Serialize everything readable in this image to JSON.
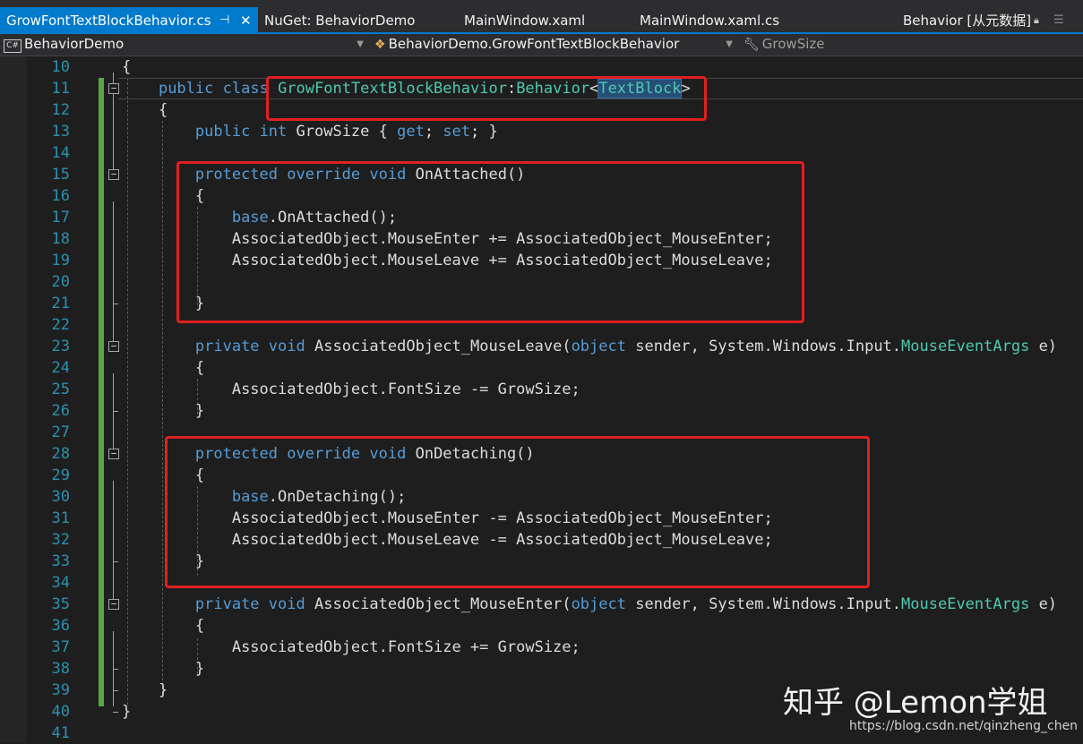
{
  "tabs": [
    {
      "label": "GrowFontTextBlockBehavior.cs",
      "active": true,
      "pin_icon": "pin-icon",
      "close_icon": "close-icon"
    },
    {
      "label": "NuGet: BehaviorDemo",
      "active": false
    },
    {
      "label": "MainWindow.xaml",
      "active": false
    },
    {
      "label": "MainWindow.xaml.cs",
      "active": false
    },
    {
      "label": "Behavior [从元数据]",
      "active": false
    }
  ],
  "navbar": {
    "project": "BehaviorDemo",
    "project_icon_text": "C#",
    "type": "BehaviorDemo.GrowFontTextBlockBehavior",
    "member": "GrowSize"
  },
  "editor": {
    "line_numbers": [
      "10",
      "11",
      "12",
      "13",
      "14",
      "15",
      "16",
      "17",
      "18",
      "19",
      "20",
      "21",
      "22",
      "23",
      "24",
      "25",
      "26",
      "27",
      "28",
      "29",
      "30",
      "31",
      "32",
      "33",
      "34",
      "35",
      "36",
      "37",
      "38",
      "39",
      "40",
      "41"
    ],
    "lines": [
      {
        "indent": "",
        "tokens": [
          {
            "t": "{"
          }
        ]
      },
      {
        "indent": "    ",
        "tokens": [
          {
            "t": "public",
            "c": "kw"
          },
          {
            "t": " "
          },
          {
            "t": "class",
            "c": "kw"
          },
          {
            "t": " "
          },
          {
            "t": "GrowFontTextBlockBehavior",
            "c": "ty"
          },
          {
            "t": ":"
          },
          {
            "t": "Behavior",
            "c": "ty"
          },
          {
            "t": "<"
          },
          {
            "t": "TextBlock",
            "c": "ty",
            "sel": true
          },
          {
            "t": ">"
          }
        ]
      },
      {
        "indent": "    ",
        "tokens": [
          {
            "t": "{"
          }
        ]
      },
      {
        "indent": "        ",
        "tokens": [
          {
            "t": "public",
            "c": "kw"
          },
          {
            "t": " "
          },
          {
            "t": "int",
            "c": "kw"
          },
          {
            "t": " GrowSize { "
          },
          {
            "t": "get",
            "c": "kw"
          },
          {
            "t": "; "
          },
          {
            "t": "set",
            "c": "kw"
          },
          {
            "t": "; }"
          }
        ]
      },
      {
        "indent": "",
        "tokens": []
      },
      {
        "indent": "        ",
        "tokens": [
          {
            "t": "protected",
            "c": "kw"
          },
          {
            "t": " "
          },
          {
            "t": "override",
            "c": "kw"
          },
          {
            "t": " "
          },
          {
            "t": "void",
            "c": "kw"
          },
          {
            "t": " OnAttached()"
          }
        ]
      },
      {
        "indent": "        ",
        "tokens": [
          {
            "t": "{"
          }
        ]
      },
      {
        "indent": "            ",
        "tokens": [
          {
            "t": "base",
            "c": "kw"
          },
          {
            "t": ".OnAttached();"
          }
        ]
      },
      {
        "indent": "            ",
        "tokens": [
          {
            "t": "AssociatedObject.MouseEnter += AssociatedObject_MouseEnter;"
          }
        ]
      },
      {
        "indent": "            ",
        "tokens": [
          {
            "t": "AssociatedObject.MouseLeave += AssociatedObject_MouseLeave;"
          }
        ]
      },
      {
        "indent": "",
        "tokens": []
      },
      {
        "indent": "        ",
        "tokens": [
          {
            "t": "}"
          }
        ]
      },
      {
        "indent": "",
        "tokens": []
      },
      {
        "indent": "        ",
        "tokens": [
          {
            "t": "private",
            "c": "kw"
          },
          {
            "t": " "
          },
          {
            "t": "void",
            "c": "kw"
          },
          {
            "t": " AssociatedObject_MouseLeave("
          },
          {
            "t": "object",
            "c": "kw"
          },
          {
            "t": " sender, System.Windows.Input."
          },
          {
            "t": "MouseEventArgs",
            "c": "ty"
          },
          {
            "t": " e)"
          }
        ]
      },
      {
        "indent": "        ",
        "tokens": [
          {
            "t": "{"
          }
        ]
      },
      {
        "indent": "            ",
        "tokens": [
          {
            "t": "AssociatedObject.FontSize -= GrowSize;"
          }
        ]
      },
      {
        "indent": "        ",
        "tokens": [
          {
            "t": "}"
          }
        ]
      },
      {
        "indent": "",
        "tokens": []
      },
      {
        "indent": "        ",
        "tokens": [
          {
            "t": "protected",
            "c": "kw"
          },
          {
            "t": " "
          },
          {
            "t": "override",
            "c": "kw"
          },
          {
            "t": " "
          },
          {
            "t": "void",
            "c": "kw"
          },
          {
            "t": " OnDetaching()"
          }
        ]
      },
      {
        "indent": "        ",
        "tokens": [
          {
            "t": "{"
          }
        ]
      },
      {
        "indent": "            ",
        "tokens": [
          {
            "t": "base",
            "c": "kw"
          },
          {
            "t": ".OnDetaching();"
          }
        ]
      },
      {
        "indent": "            ",
        "tokens": [
          {
            "t": "AssociatedObject.MouseEnter -= AssociatedObject_MouseEnter;"
          }
        ]
      },
      {
        "indent": "            ",
        "tokens": [
          {
            "t": "AssociatedObject.MouseLeave -= AssociatedObject_MouseLeave;"
          }
        ]
      },
      {
        "indent": "        ",
        "tokens": [
          {
            "t": "}"
          }
        ]
      },
      {
        "indent": "",
        "tokens": []
      },
      {
        "indent": "        ",
        "tokens": [
          {
            "t": "private",
            "c": "kw"
          },
          {
            "t": " "
          },
          {
            "t": "void",
            "c": "kw"
          },
          {
            "t": " AssociatedObject_MouseEnter("
          },
          {
            "t": "object",
            "c": "kw"
          },
          {
            "t": " sender, System.Windows.Input."
          },
          {
            "t": "MouseEventArgs",
            "c": "ty"
          },
          {
            "t": " e)"
          }
        ]
      },
      {
        "indent": "        ",
        "tokens": [
          {
            "t": "{"
          }
        ]
      },
      {
        "indent": "            ",
        "tokens": [
          {
            "t": "AssociatedObject.FontSize += GrowSize;"
          }
        ]
      },
      {
        "indent": "        ",
        "tokens": [
          {
            "t": "}"
          }
        ]
      },
      {
        "indent": "    ",
        "tokens": [
          {
            "t": "}"
          }
        ]
      },
      {
        "indent": "",
        "tokens": [
          {
            "t": "}"
          }
        ]
      },
      {
        "indent": "",
        "tokens": []
      }
    ],
    "colors": {
      "keyword": "#569cd6",
      "type": "#4ec9b0",
      "text": "#dcdcdc",
      "line_number": "#2b91af",
      "highlight_box": "#e02020"
    }
  },
  "watermark": {
    "text": "知乎 @Lemon学姐",
    "url": "https://blog.csdn.net/qinzheng_chen"
  }
}
